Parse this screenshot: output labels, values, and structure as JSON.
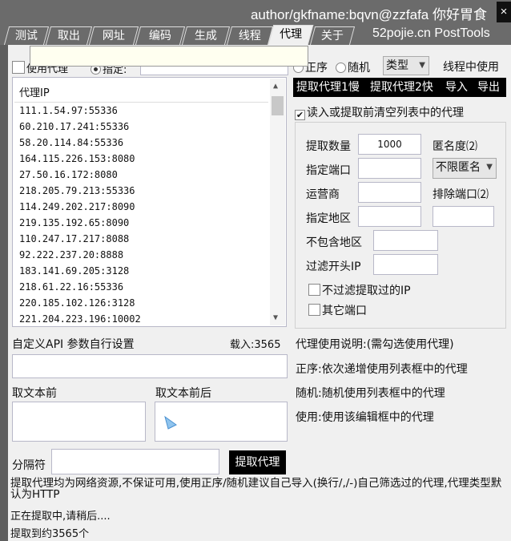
{
  "window": {
    "title": "author/gkfname:bqvn@zzfafa 你好胃食",
    "close": "×"
  },
  "tabs": [
    "测试",
    "取出",
    "网址",
    "编码",
    "生成",
    "线程",
    "代理",
    "关于"
  ],
  "active_tab": "代理",
  "site": "52pojie.cn  PostTools",
  "top_row": {
    "use_proxy": "使用代理",
    "specify": "指定:",
    "order": "正序",
    "random": "随机",
    "type_select": "类型",
    "thread_use": "线程中使用"
  },
  "proxy_list": {
    "header": "代理IP",
    "items": [
      "111.1.54.97:55336",
      "60.210.17.241:55336",
      "58.20.114.84:55336",
      "164.115.226.153:8080",
      "27.50.16.172:8080",
      "218.205.79.213:55336",
      "114.249.202.217:8090",
      "219.135.192.65:8090",
      "110.247.17.217:8088",
      "92.222.237.20:8888",
      "183.141.69.205:3128",
      "218.61.22.16:55336",
      "220.185.102.126:3128",
      "221.204.223.196:10002"
    ]
  },
  "actions": {
    "fetch1": "提取代理1慢",
    "fetch2": "提取代理2快",
    "import": "导入",
    "export": "导出"
  },
  "clear_before": "读入或提取前清空列表中的代理",
  "options": {
    "count_label": "提取数量",
    "count_value": "1000",
    "anon_label": "匿名度⑵",
    "port_label": "指定端口",
    "anon_select": "不限匿名",
    "isp_label": "运营商",
    "exclude_port_label": "排除端口⑵",
    "region_label": "指定地区",
    "exclude_region_label": "不包含地区",
    "filter_ip_label": "过滤开头IP",
    "no_filter_label": "不过滤提取过的IP",
    "other_port_label": "其它端口"
  },
  "api": {
    "label": "自定义API 参数自行设置",
    "loaded": "载入:3565",
    "before_label": "取文本前",
    "after_label": "取文本前后",
    "sep_label": "分隔符",
    "fetch_button": "提取代理"
  },
  "help": {
    "title": "代理使用说明:(需勾选使用代理)",
    "order": "正序:依次递增使用列表框中的代理",
    "random": "随机:随机使用列表框中的代理",
    "use": "使用:使用该编辑框中的代理"
  },
  "notes": {
    "disclaimer": "提取代理均为网络资源,不保证可用,使用正序/随机建议自己导入(换行/,/-)自己筛选过的代理,代理类型默认为HTTP",
    "status": "正在提取中,请稍后....",
    "result": "提取到约3565个"
  }
}
